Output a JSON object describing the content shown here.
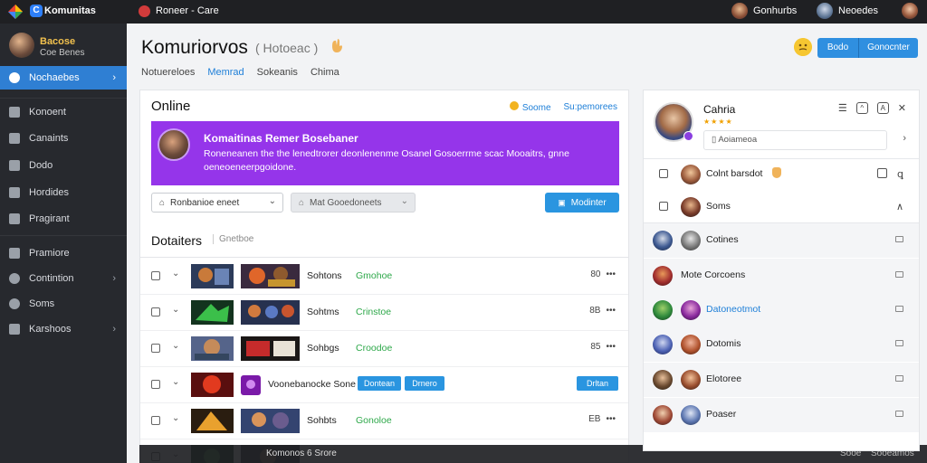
{
  "topbar": {
    "brand": "Komunitas",
    "center": "Roneer - Care",
    "users": [
      {
        "name": "Gonhurbs"
      },
      {
        "name": "Neoedes"
      }
    ]
  },
  "sidebar": {
    "profile": {
      "name": "Bacose",
      "sub": "Coe Benes"
    },
    "items": [
      {
        "label": "Nochaebes",
        "icon": "user-icon",
        "active": true
      },
      {
        "label": "Konoent",
        "icon": "home-icon"
      },
      {
        "label": "Canaints",
        "icon": "calendar-icon"
      },
      {
        "label": "Dodo",
        "icon": "person-icon"
      },
      {
        "label": "Hordides",
        "icon": "star-icon"
      },
      {
        "label": "Pragirant",
        "icon": "clipboard-icon"
      },
      {
        "label": "Pramiore",
        "icon": "person-icon"
      },
      {
        "label": "Contintion",
        "icon": "circle-icon",
        "chevron": "›"
      },
      {
        "label": "Soms",
        "icon": "circle-icon"
      },
      {
        "label": "Karshoos",
        "icon": "gear-icon",
        "chevron": "›"
      }
    ]
  },
  "header": {
    "title": "Komuriorvos",
    "subtitle": "( Hotoeac )",
    "tabs": [
      "Notuereloes",
      "Memrad",
      "Sokeanis",
      "Chima"
    ],
    "active_tab": 1,
    "buttons": [
      "Bodo",
      "Gonocnter"
    ]
  },
  "online": {
    "title": "Online",
    "links": [
      "Soome",
      "Su:pemorees"
    ]
  },
  "banner": {
    "heading": "Komaitinas Remer Bosebaner",
    "text": "Roneneanen the the lenedtrorer deonlenenme Osanel Gosoerrme scac Mooaitrs, gnne oeneoeneerpgoidone.",
    "color": "#9535ea"
  },
  "filters": {
    "select1": "Ronbanioe eneet",
    "select2": "Mat Gooedoneets",
    "moderate_button": "Modinter"
  },
  "section": {
    "title": "Dotaiters",
    "subtitle": "Gnetboe"
  },
  "rows": [
    {
      "name": "Sohtons",
      "status": "Gmohoe",
      "meta": "80",
      "more": "•••"
    },
    {
      "name": "Sohtms",
      "status": "Crinstoe",
      "meta": "8B",
      "more": "•••"
    },
    {
      "name": "Sohbgs",
      "status": "Croodoe",
      "meta": "85",
      "more": "•••"
    },
    {
      "name": "Voonebanocke Sone",
      "tags": [
        "Dontean",
        "Drnero"
      ],
      "action": "Drltan"
    },
    {
      "name": "Sohbts",
      "status": "Gonoloe",
      "meta": "EB",
      "more": "•••"
    },
    {
      "name": "Komonos 6 Srore",
      "status": "",
      "meta": "",
      "more": ""
    }
  ],
  "bottombar": {
    "center": "Komonos 6 Srore",
    "right1": "Sooe",
    "right2": "Sooeamos"
  },
  "right_panel": {
    "name": "Cahria",
    "stars": "★★★★",
    "search_placeholder": "Aoiameoa",
    "rows": [
      {
        "label": "Colnt barsdot",
        "type": "checkbox",
        "emoji": "hand-icon"
      },
      {
        "label": "Soms",
        "type": "checkbox"
      },
      {
        "label": "Cotines",
        "type": "avatar"
      },
      {
        "label": "Mote Corcoens",
        "type": "avatar"
      },
      {
        "label": "Datoneotmot",
        "type": "avatar",
        "link": true
      },
      {
        "label": "Dotomis",
        "type": "avatar"
      },
      {
        "label": "Elotoree",
        "type": "avatar"
      },
      {
        "label": "Poaser",
        "type": "avatar"
      }
    ]
  }
}
